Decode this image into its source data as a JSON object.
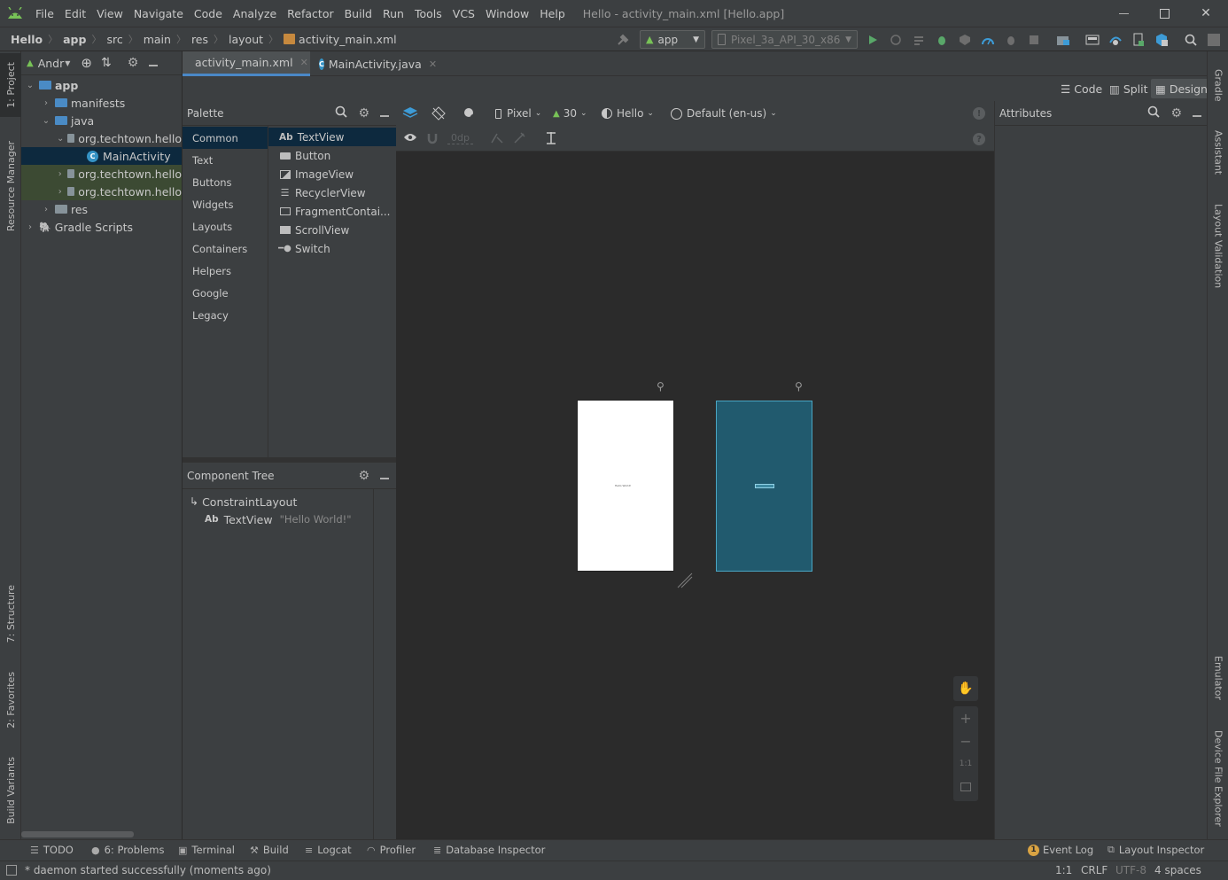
{
  "menu": {
    "items": [
      "File",
      "Edit",
      "View",
      "Navigate",
      "Code",
      "Analyze",
      "Refactor",
      "Build",
      "Run",
      "Tools",
      "VCS",
      "Window",
      "Help"
    ],
    "window_title": "Hello - activity_main.xml [Hello.app]"
  },
  "navbar": {
    "breadcrumbs": [
      "Hello",
      "app",
      "src",
      "main",
      "res",
      "layout",
      "activity_main.xml"
    ],
    "run_config": "app",
    "device": "Pixel_3a_API_30_x86"
  },
  "left_stripe": {
    "project": "1: Project",
    "resource_manager": "Resource Manager",
    "structure": "7: Structure",
    "favorites": "2: Favorites",
    "build_variants": "Build Variants"
  },
  "right_stripe": {
    "gradle": "Gradle",
    "assistant": "Assistant",
    "layout_validation": "Layout Validation",
    "emulator": "Emulator",
    "device_file_explorer": "Device File Explorer"
  },
  "project": {
    "view_label": "Andr",
    "tree": [
      {
        "label": "app",
        "level": 0,
        "kind": "module",
        "expanded": true
      },
      {
        "label": "manifests",
        "level": 1,
        "kind": "folder-blue",
        "expanded": false
      },
      {
        "label": "java",
        "level": 1,
        "kind": "folder-blue",
        "expanded": true
      },
      {
        "label": "org.techtown.hello",
        "level": 2,
        "kind": "package",
        "expanded": true
      },
      {
        "label": "MainActivity",
        "level": 3,
        "kind": "class",
        "selected": true
      },
      {
        "label": "org.techtown.hello",
        "level": 2,
        "kind": "package",
        "expanded": false,
        "highlight": true
      },
      {
        "label": "org.techtown.hello",
        "level": 2,
        "kind": "package",
        "expanded": false,
        "highlight": true
      },
      {
        "label": "res",
        "level": 1,
        "kind": "folder",
        "expanded": false
      },
      {
        "label": "Gradle Scripts",
        "level": 0,
        "kind": "gradle",
        "expanded": false
      }
    ]
  },
  "editor_tabs": [
    {
      "label": "activity_main.xml",
      "active": true
    },
    {
      "label": "MainActivity.java",
      "active": false
    }
  ],
  "modes": {
    "code": "Code",
    "split": "Split",
    "design": "Design"
  },
  "palette": {
    "title": "Palette",
    "categories": [
      "Common",
      "Text",
      "Buttons",
      "Widgets",
      "Layouts",
      "Containers",
      "Helpers",
      "Google",
      "Legacy"
    ],
    "items": [
      "TextView",
      "Button",
      "ImageView",
      "RecyclerView",
      "FragmentContai...",
      "ScrollView",
      "Switch"
    ],
    "textview_prefix": "Ab"
  },
  "component_tree": {
    "title": "Component Tree",
    "root": "ConstraintLayout",
    "child_prefix": "Ab",
    "child": "TextView",
    "child_text": "\"Hello World!\""
  },
  "surface_toolbar": {
    "device": "Pixel",
    "api": "30",
    "theme": "Hello",
    "locale": "Default (en-us)",
    "margin": "0dp"
  },
  "canvas": {
    "design_text": "Hello World!",
    "design_bg": "#ffffff",
    "blueprint_bg": "#215a6e"
  },
  "attributes": {
    "title": "Attributes"
  },
  "bottom_tabs": {
    "todo": "TODO",
    "problems": "6: Problems",
    "terminal": "Terminal",
    "build": "Build",
    "logcat": "Logcat",
    "profiler": "Profiler",
    "database_inspector": "Database Inspector",
    "event_log": "Event Log",
    "event_count": "1",
    "layout_inspector": "Layout Inspector"
  },
  "status": {
    "message": "* daemon started successfully (moments ago)",
    "position": "1:1",
    "line_sep": "CRLF",
    "encoding": "UTF-8",
    "indent": "4 spaces"
  },
  "colors": {
    "accent": "#4a88c7",
    "selection": "#0d293e",
    "android_green": "#78c257",
    "run_green": "#59a869"
  }
}
